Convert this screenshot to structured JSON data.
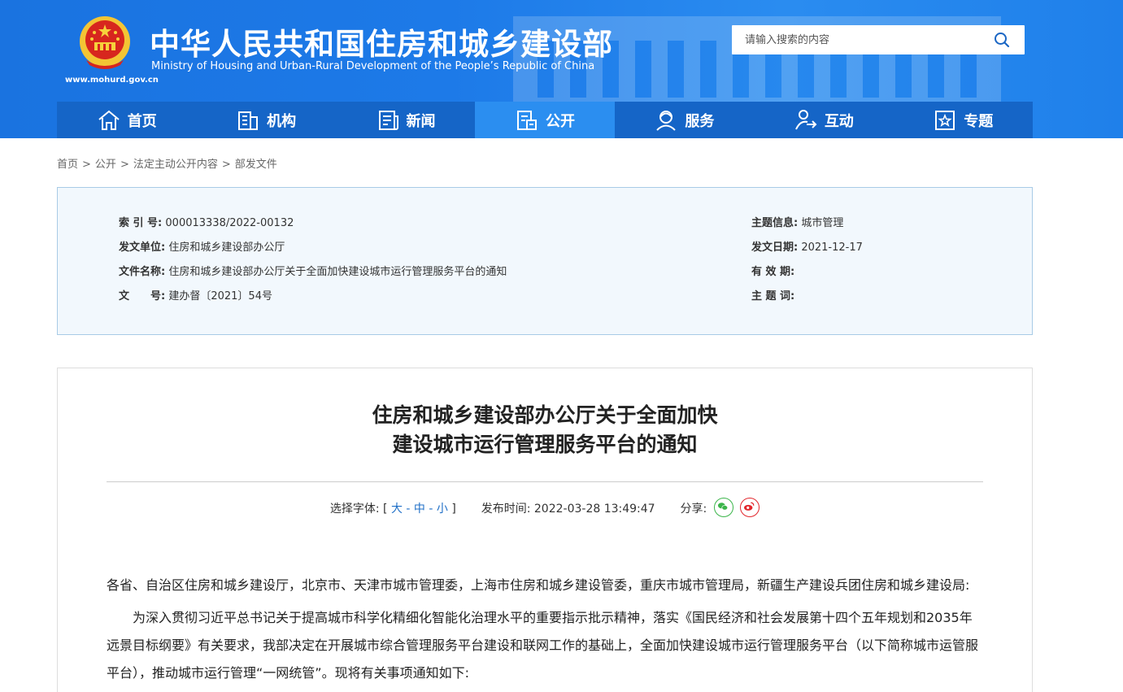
{
  "header": {
    "site_title": "中华人民共和国住房和城乡建设部",
    "site_subtitle": "Ministry of Housing and Urban-Rural Development of the People’s Republic of China",
    "site_url": "www.mohurd.gov.cn",
    "search_placeholder": "请输入搜索的内容",
    "colors": {
      "header_blue": "#1d7ae8",
      "nav_blue": "#1565c7",
      "nav_active": "#2b8ef0"
    }
  },
  "nav": {
    "items": [
      {
        "label": "首页",
        "icon": "home-icon"
      },
      {
        "label": "机构",
        "icon": "building-icon"
      },
      {
        "label": "新闻",
        "icon": "news-icon"
      },
      {
        "label": "公开",
        "icon": "document-icon",
        "active": true
      },
      {
        "label": "服务",
        "icon": "service-icon"
      },
      {
        "label": "互动",
        "icon": "interact-icon"
      },
      {
        "label": "专题",
        "icon": "star-icon"
      }
    ]
  },
  "breadcrumb": {
    "items": [
      "首页",
      "公开",
      "法定主动公开内容",
      "部发文件"
    ],
    "separator": ">"
  },
  "info": {
    "index_label": "索 引 号:",
    "index_value": "000013338/2022-00132",
    "issuer_label": "发文单位:",
    "issuer_value": "住房和城乡建设部办公厅",
    "filename_label": "文件名称:",
    "filename_value": "住房和城乡建设部办公厅关于全面加快建设城市运行管理服务平台的通知",
    "docno_label": "文　　号:",
    "docno_value": "建办督〔2021〕54号",
    "topic_label": "主题信息:",
    "topic_value": "城市管理",
    "date_label": "发文日期:",
    "date_value": "2021-12-17",
    "validity_label": "有 效 期:",
    "validity_value": "",
    "keywords_label": "主 题 词:",
    "keywords_value": ""
  },
  "article": {
    "title_line1": "住房和城乡建设部办公厅关于全面加快",
    "title_line2": "建设城市运行管理服务平台的通知",
    "font_label": "选择字体:",
    "font_open": "[",
    "font_large": "大",
    "font_dash1": "-",
    "font_medium": "中",
    "font_dash2": "-",
    "font_small": "小",
    "font_close": "]",
    "publish_label": "发布时间:",
    "publish_time": "2022-03-28 13:49:47",
    "share_label": "分享:",
    "para1": "各省、自治区住房和城乡建设厅，北京市、天津市城市管理委，上海市住房和城乡建设管委，重庆市城市管理局，新疆生产建设兵团住房和城乡建设局:",
    "para2": "为深入贯彻习近平总书记关于提高城市科学化精细化智能化治理水平的重要指示批示精神，落实《国民经济和社会发展第十四个五年规划和2035年远景目标纲要》有关要求，我部决定在开展城市综合管理服务平台建设和联网工作的基础上，全面加快建设城市运行管理服务平台（以下简称城市运管服平台），推动城市运行管理“一网统管”。现将有关事项通知如下:"
  }
}
